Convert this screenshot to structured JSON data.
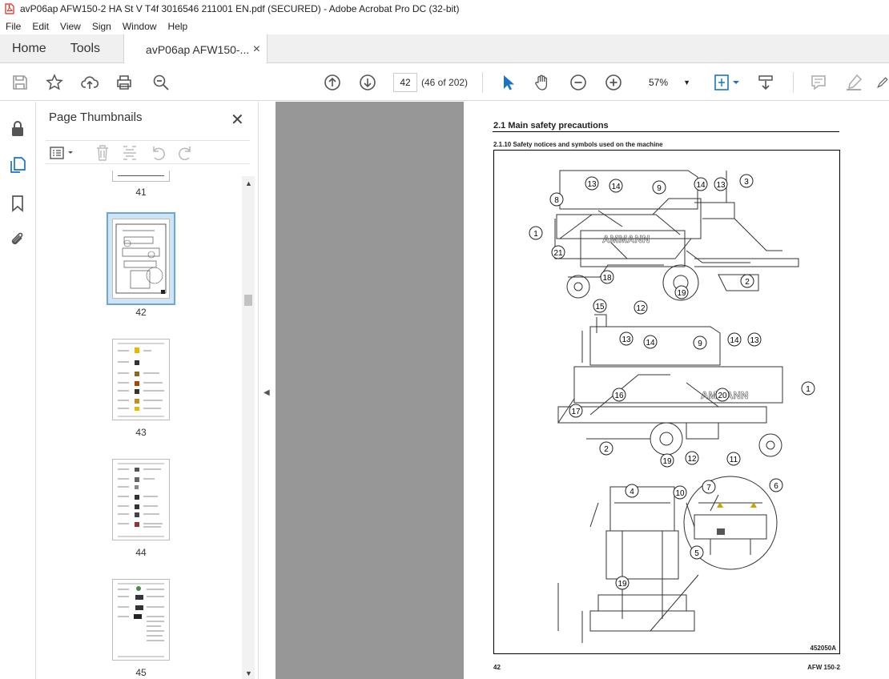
{
  "window": {
    "title": "avP06ap AFW150-2 HA St V T4f 3016546 211001 EN.pdf (SECURED) - Adobe Acrobat Pro DC (32-bit)"
  },
  "menu": {
    "items": [
      "File",
      "Edit",
      "View",
      "Sign",
      "Window",
      "Help"
    ]
  },
  "tabs": {
    "home": "Home",
    "tools": "Tools",
    "document": "avP06ap AFW150-...",
    "close": "×"
  },
  "toolbar": {
    "page_current": "42",
    "page_count": "(46 of 202)",
    "zoom": "57%",
    "icons": [
      "save-icon",
      "bookmark-star-icon",
      "upload-icon",
      "print-icon",
      "search-zoom-icon",
      "page-up-icon",
      "page-down-icon",
      "select-cursor-icon",
      "hand-icon",
      "zoom-out-icon",
      "zoom-in-icon",
      "fit-page-icon",
      "scroll-mode-icon",
      "comment-icon",
      "highlight-icon",
      "sign-icon"
    ]
  },
  "left_rail": {
    "icons": [
      "lock-icon",
      "page-thumbnails-icon",
      "bookmarks-icon",
      "attachments-icon"
    ]
  },
  "thumbnails_panel": {
    "title": "Page Thumbnails",
    "close": "✕",
    "pages": [
      {
        "label": "41",
        "selected": false
      },
      {
        "label": "42",
        "selected": true
      },
      {
        "label": "43",
        "selected": false
      },
      {
        "label": "44",
        "selected": false
      },
      {
        "label": "45",
        "selected": false
      }
    ]
  },
  "document_page": {
    "section_title": "2.1      Main safety precautions",
    "subsection_title": "2.1.10     Safety notices and symbols used on the machine",
    "brand_on_machine": "AMMANN",
    "figure_code": "452050A",
    "page_number": "42",
    "model": "AFW 150-2",
    "callouts_view1": [
      "13",
      "14",
      "9",
      "14",
      "13",
      "3",
      "8",
      "1",
      "21",
      "18",
      "15",
      "12",
      "19",
      "2"
    ],
    "callouts_view2": [
      "13",
      "14",
      "9",
      "14",
      "13",
      "1",
      "20",
      "16",
      "17",
      "2",
      "19",
      "12",
      "11"
    ],
    "callouts_view3": [
      "4",
      "10",
      "7",
      "6",
      "5",
      "19"
    ]
  }
}
